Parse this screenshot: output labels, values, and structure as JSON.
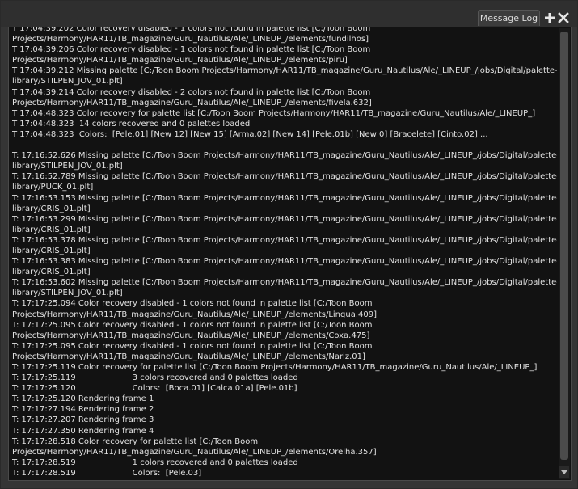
{
  "panel": {
    "tab_label": "Message Log",
    "add_icon": "plus-icon",
    "close_icon": "close-icon"
  },
  "log_lines": [
    "T 17:04:39.202 Color recovery disabled - 1 colors not found in palette list [C:/Toon Boom",
    "Projects/Harmony/HAR11/TB_magazine/Guru_Nautilus/Ale/_LINEUP_/elements/fundilhos]",
    "T 17:04:39.206 Color recovery disabled - 1 colors not found in palette list [C:/Toon Boom",
    "Projects/Harmony/HAR11/TB_magazine/Guru_Nautilus/Ale/_LINEUP_/elements/piru]",
    "T 17:04:39.212 Missing palette [C:/Toon Boom Projects/Harmony/HAR11/TB_magazine/Guru_Nautilus/Ale/_LINEUP_/jobs/Digital/palette-",
    "library/STILPEN_JOV_01.plt]",
    "T 17:04:39.214 Color recovery disabled - 2 colors not found in palette list [C:/Toon Boom",
    "Projects/Harmony/HAR11/TB_magazine/Guru_Nautilus/Ale/_LINEUP_/elements/fivela.632]",
    "T 17:04:48.323 Color recovery for palette list [C:/Toon Boom Projects/Harmony/HAR11/TB_magazine/Guru_Nautilus/Ale/_LINEUP_]",
    "T 17:04:48.323  14 colors recovered and 0 palettes loaded",
    "T 17:04:48.323  Colors:  [Pele.01] [New 12] [New 15] [Arma.02] [New 14] [Pele.01b] [New 0] [Bracelete] [Cinto.02] ...",
    "",
    "T: 17:16:52.626 Missing palette [C:/Toon Boom Projects/Harmony/HAR11/TB_magazine/Guru_Nautilus/Ale/_LINEUP_/jobs/Digital/palette-",
    "library/STILPEN_JOV_01.plt]",
    "T: 17:16:52.789 Missing palette [C:/Toon Boom Projects/Harmony/HAR11/TB_magazine/Guru_Nautilus/Ale/_LINEUP_/jobs/Digital/palette-",
    "library/PUCK_01.plt]",
    "T: 17:16:53.153 Missing palette [C:/Toon Boom Projects/Harmony/HAR11/TB_magazine/Guru_Nautilus/Ale/_LINEUP_/jobs/Digital/palette-",
    "library/CRIS_01.plt]",
    "T: 17:16:53.299 Missing palette [C:/Toon Boom Projects/Harmony/HAR11/TB_magazine/Guru_Nautilus/Ale/_LINEUP_/jobs/Digital/palette-",
    "library/CRIS_01.plt]",
    "T: 17:16:53.378 Missing palette [C:/Toon Boom Projects/Harmony/HAR11/TB_magazine/Guru_Nautilus/Ale/_LINEUP_/jobs/Digital/palette-",
    "library/CRIS_01.plt]",
    "T: 17:16:53.383 Missing palette [C:/Toon Boom Projects/Harmony/HAR11/TB_magazine/Guru_Nautilus/Ale/_LINEUP_/jobs/Digital/palette-",
    "library/CRIS_01.plt]",
    "T: 17:16:53.602 Missing palette [C:/Toon Boom Projects/Harmony/HAR11/TB_magazine/Guru_Nautilus/Ale/_LINEUP_/jobs/Digital/palette-",
    "library/STILPEN_JOV_01.plt]",
    "T: 17:17:25.094 Color recovery disabled - 1 colors not found in palette list [C:/Toon Boom",
    "Projects/Harmony/HAR11/TB_magazine/Guru_Nautilus/Ale/_LINEUP_/elements/Lingua.409]",
    "T: 17:17:25.095 Color recovery disabled - 1 colors not found in palette list [C:/Toon Boom",
    "Projects/Harmony/HAR11/TB_magazine/Guru_Nautilus/Ale/_LINEUP_/elements/Coxa.475]",
    "T: 17:17:25.095 Color recovery disabled - 1 colors not found in palette list [C:/Toon Boom",
    "Projects/Harmony/HAR11/TB_magazine/Guru_Nautilus/Ale/_LINEUP_/elements/Nariz.01]",
    "T: 17:17:25.119 Color recovery for palette list [C:/Toon Boom Projects/Harmony/HAR11/TB_magazine/Guru_Nautilus/Ale/_LINEUP_]",
    "T: 17:17:25.119                      3 colors recovered and 0 palettes loaded",
    "T: 17:17:25.120                      Colors:  [Boca.01] [Calca.01a] [Pele.01b]",
    "T: 17:17:25.120 Rendering frame 1",
    "T: 17:17:27.194 Rendering frame 2",
    "T: 17:17:27.207 Rendering frame 3",
    "T: 17:17:27.350 Rendering frame 4",
    "T: 17:17:28.518 Color recovery for palette list [C:/Toon Boom",
    "Projects/Harmony/HAR11/TB_magazine/Guru_Nautilus/Ale/_LINEUP_/elements/Orelha.357]",
    "T: 17:17:28.519                      1 colors recovered and 0 palettes loaded",
    "T: 17:17:28.519                      Colors:  [Pele.03]"
  ]
}
